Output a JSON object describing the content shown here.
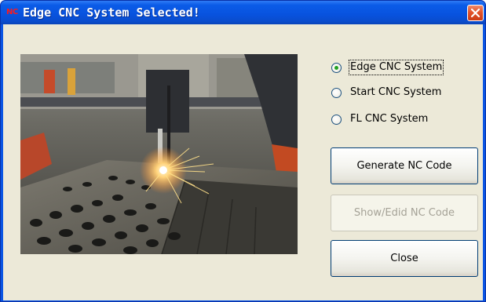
{
  "window": {
    "app_icon_text": "NC",
    "title": "Edge CNC System Selected!"
  },
  "options": [
    {
      "label": "Edge CNC System",
      "selected": true
    },
    {
      "label": "Start CNC System",
      "selected": false
    },
    {
      "label": "FL CNC System",
      "selected": false
    }
  ],
  "buttons": {
    "generate": "Generate NC Code",
    "show_edit": "Show/Edid NC Code",
    "close": "Close"
  },
  "image": {
    "description_icon": "cnc-plasma-cutting-photo"
  },
  "colors": {
    "titlebar": "#0852de",
    "dialog_bg": "#ece9d8",
    "close_button": "#e2532b",
    "radio_dot": "#21a121"
  }
}
